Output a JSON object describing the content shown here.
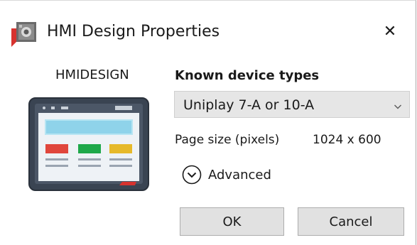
{
  "window": {
    "title": "HMI Design Properties",
    "app_icon": "hmi-app-icon",
    "close_icon": "close-icon",
    "close_glyph": "✕"
  },
  "device": {
    "name": "HMIDESIGN",
    "image": "hmi-panel-illustration"
  },
  "known_devices": {
    "heading": "Known device types",
    "selected": "Uniplay 7-A or 10-A",
    "arrow_icon": "chevron-down-icon"
  },
  "page_size": {
    "label": "Page size (pixels)",
    "value": "1024 x 600"
  },
  "advanced": {
    "label": "Advanced",
    "icon": "expand-circle-icon"
  },
  "buttons": {
    "ok": "OK",
    "cancel": "Cancel"
  },
  "colors": {
    "accent_red": "#d7332f",
    "panel_frame": "#3a4452",
    "screen_bg": "#eef2f6",
    "header_bar": "#8fd3ea",
    "tile_red": "#e0463c",
    "tile_green": "#1ea84a",
    "tile_yellow": "#e6b92a"
  }
}
